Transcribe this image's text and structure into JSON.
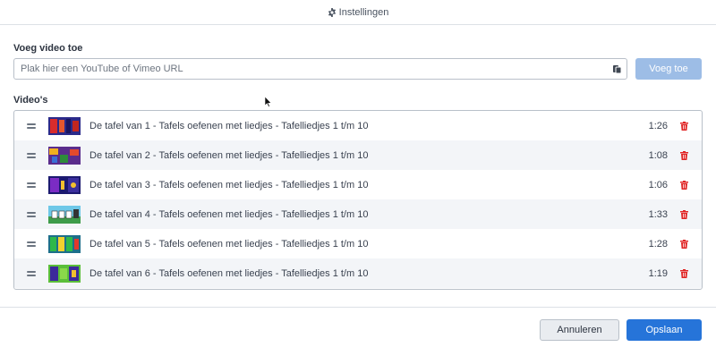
{
  "header": {
    "title": "Instellingen",
    "icon": "gear-icon"
  },
  "add_section": {
    "label": "Voeg video toe",
    "url_placeholder": "Plak hier een YouTube of Vimeo URL",
    "url_value": "",
    "paste_icon": "paste-icon",
    "add_button": "Voeg toe"
  },
  "videos_section": {
    "label": "Video's",
    "items": [
      {
        "title": "De tafel van 1 - Tafels oefenen met liedjes - Tafelliedjes 1 t/m 10",
        "duration": "1:26"
      },
      {
        "title": "De tafel van 2 - Tafels oefenen met liedjes - Tafelliedjes 1 t/m 10",
        "duration": "1:08"
      },
      {
        "title": "De tafel van 3 - Tafels oefenen met liedjes - Tafelliedjes 1 t/m 10",
        "duration": "1:06"
      },
      {
        "title": "De tafel van 4 - Tafels oefenen met liedjes - Tafelliedjes 1 t/m 10",
        "duration": "1:33"
      },
      {
        "title": "De tafel van 5 - Tafels oefenen met liedjes - Tafelliedjes 1 t/m 10",
        "duration": "1:28"
      },
      {
        "title": "De tafel van 6 - Tafels oefenen met liedjes - Tafelliedjes 1 t/m 10",
        "duration": "1:19"
      }
    ]
  },
  "footer": {
    "cancel_button": "Annuleren",
    "save_button": "Opslaan"
  },
  "colors": {
    "primary": "#2674d9",
    "primary_disabled": "#9dbde6",
    "danger": "#e02424",
    "row_alt": "#f3f5f8"
  }
}
